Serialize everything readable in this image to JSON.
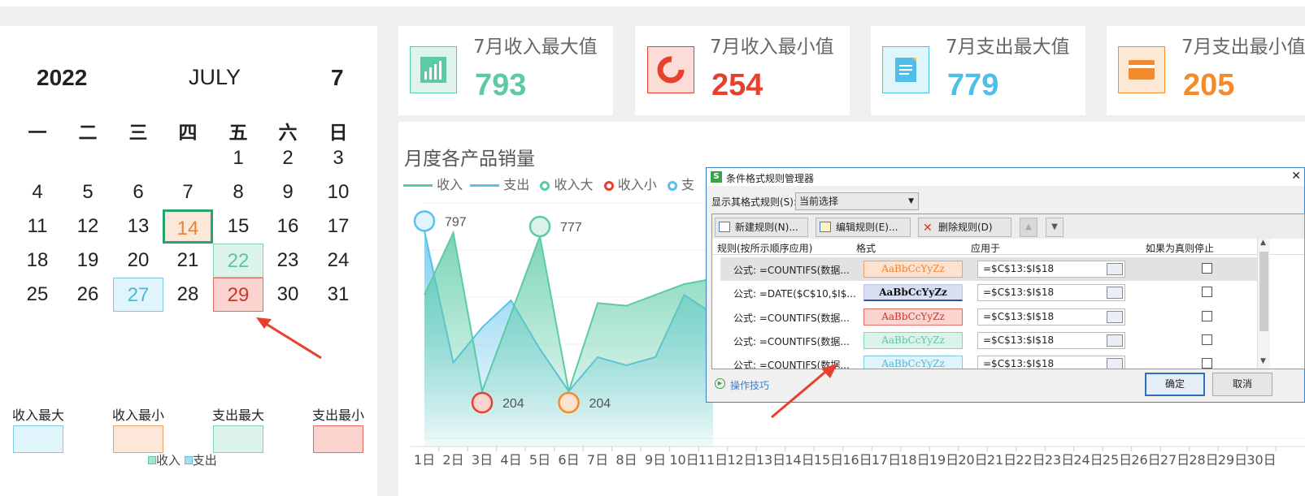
{
  "calendar": {
    "year": "2022",
    "month_name": "JULY",
    "month_num": "7",
    "weekdays": [
      "一",
      "二",
      "三",
      "四",
      "五",
      "六",
      "日"
    ],
    "days": [
      "1",
      "2",
      "3",
      "4",
      "5",
      "6",
      "7",
      "8",
      "9",
      "10",
      "11",
      "12",
      "13",
      "14",
      "15",
      "16",
      "17",
      "18",
      "19",
      "20",
      "21",
      "22",
      "23",
      "24",
      "25",
      "26",
      "27",
      "28",
      "29",
      "30",
      "31"
    ],
    "highlights": {
      "today": "14",
      "income_max": "27",
      "income_min": "14",
      "expense_max": "22",
      "expense_min": "29"
    }
  },
  "legend": {
    "items": [
      {
        "label": "收入最大",
        "color": "#dff4fb"
      },
      {
        "label": "收入最小",
        "color": "#fde7d8"
      },
      {
        "label": "支出最大",
        "color": "#dcf3ea"
      },
      {
        "label": "支出最小",
        "color": "#fbd4cf"
      }
    ],
    "bottom_income": "收入",
    "bottom_expense": "支出"
  },
  "cards": [
    {
      "title": "7月收入最大值",
      "value": "793",
      "color": "#5ccba5",
      "icon": "bar-chart-icon"
    },
    {
      "title": "7月收入最小值",
      "value": "254",
      "color": "#e8402d",
      "icon": "donut-icon"
    },
    {
      "title": "7月支出最大值",
      "value": "779",
      "color": "#4fbfe8",
      "icon": "document-icon"
    },
    {
      "title": "7月支出最小值",
      "value": "205",
      "color": "#f58a2a",
      "icon": "card-icon"
    }
  ],
  "chart_data": {
    "type": "area",
    "title": "月度各产品销量",
    "legend": [
      "收入",
      "支出",
      "收入大",
      "收入小",
      "支"
    ],
    "categories": [
      "1日",
      "2日",
      "3日",
      "4日",
      "5日",
      "6日",
      "7日",
      "8日",
      "9日",
      "10日",
      "11日",
      "12日",
      "13日",
      "14日",
      "15日",
      "16日",
      "17日",
      "18日",
      "19日",
      "20日",
      "21日",
      "22日",
      "23日",
      "24日",
      "25日",
      "26日",
      "27日",
      "28日",
      "29日",
      "30日"
    ],
    "series": [
      {
        "name": "收入",
        "color": "#5ccba5",
        "values": [
          560,
          790,
          204,
          490,
          777,
          204,
          530,
          520,
          560,
          600,
          620
        ]
      },
      {
        "name": "支出",
        "color": "#5bc0eb",
        "values": [
          797,
          310,
          440,
          540,
          360,
          204,
          330,
          300,
          330,
          560,
          490
        ]
      }
    ],
    "annotations": [
      {
        "x": "1日",
        "value": "797"
      },
      {
        "x": "5日",
        "value": "777"
      },
      {
        "x": "3日",
        "value": "204"
      },
      {
        "x": "6日",
        "value": "204"
      }
    ],
    "ylim": [
      0,
      900
    ]
  },
  "dialog": {
    "title": "条件格式规则管理器",
    "show_rules_label": "显示其格式规则(S):",
    "show_rules_value": "当前选择",
    "new_rule": "新建规则(N)...",
    "edit_rule": "编辑规则(E)...",
    "delete_rule": "删除规则(D)",
    "col_rule": "规则(按所示顺序应用)",
    "col_format": "格式",
    "col_apply": "应用于",
    "col_stop": "如果为真则停止",
    "rules": [
      {
        "formula": "公式: =COUNTIFS(数据...",
        "preview": "AaBbCcYyZz",
        "applies": "=$C$13:$I$18"
      },
      {
        "formula": "公式: =DATE($C$10,$I$...",
        "preview": "AaBbCcYyZz",
        "applies": "=$C$13:$I$18"
      },
      {
        "formula": "公式: =COUNTIFS(数据...",
        "preview": "AaBbCcYyZz",
        "applies": "=$C$13:$I$18"
      },
      {
        "formula": "公式: =COUNTIFS(数据...",
        "preview": "AaBbCcYyZz",
        "applies": "=$C$13:$I$18"
      },
      {
        "formula": "公式: =COUNTIFS(数据...",
        "preview": "AaBbCcYyZz",
        "applies": "=$C$13:$I$18"
      }
    ],
    "tips": "操作技巧",
    "ok": "确定",
    "cancel": "取消",
    "close": "✕",
    "app_badge": "S"
  }
}
